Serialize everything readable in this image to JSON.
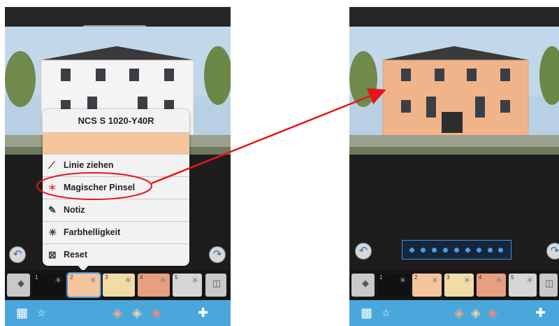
{
  "left_screen": {
    "popup": {
      "color_name": "NCS S 1020-Y40R",
      "color_hex": "#f5c59b",
      "menu_items": [
        {
          "label": "Linie ziehen",
          "icon": "line-draw-icon"
        },
        {
          "label": "Magischer Pinsel",
          "icon": "magic-brush-icon"
        },
        {
          "label": "Notiz",
          "icon": "note-icon"
        },
        {
          "label": "Farbhelligkeit",
          "icon": "brightness-icon"
        },
        {
          "label": "Reset",
          "icon": "reset-icon"
        }
      ],
      "highlighted_item": "Magischer Pinsel"
    },
    "swatches": [
      {
        "number": "1",
        "color": "#111111"
      },
      {
        "number": "2",
        "color": "#f5c59b"
      },
      {
        "number": "3",
        "color": "#f2dca6"
      },
      {
        "number": "4",
        "color": "#e89e80"
      },
      {
        "number": "5",
        "color": "#d6d6d6"
      }
    ]
  },
  "right_screen": {
    "progress_dots": 9,
    "swatches": [
      {
        "number": "1",
        "color": "#111111"
      },
      {
        "number": "2",
        "color": "#f5c59b"
      },
      {
        "number": "3",
        "color": "#f2dca6"
      },
      {
        "number": "4",
        "color": "#e89e80"
      },
      {
        "number": "5",
        "color": "#d6d6d6"
      }
    ]
  },
  "colors": {
    "bottom_bar": "#4aa7dc",
    "annotation_red": "#e8141c",
    "house_painted": "#f0b48b",
    "house_original": "#f4f4f4"
  }
}
